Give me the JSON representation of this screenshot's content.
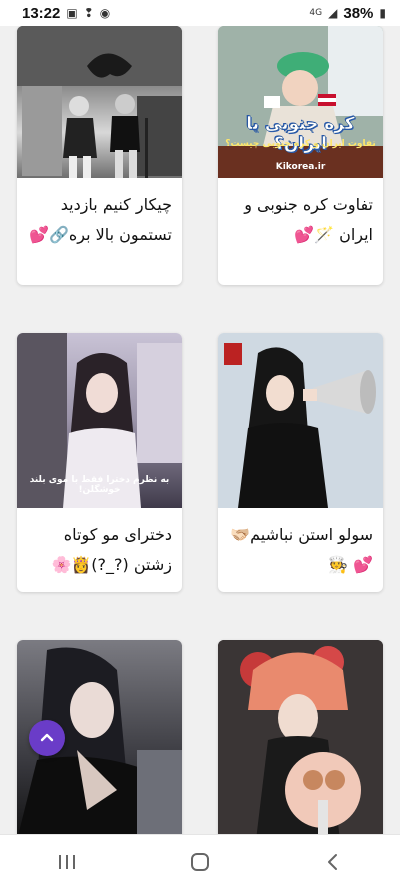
{
  "status_bar": {
    "time": "13:22",
    "network": "4G",
    "battery": "38%"
  },
  "cards": [
    {
      "title": "چیکار کنیم بازدید تستمون بالا بره🔗💕",
      "image_desc": "two girls in recording studio, black and white"
    },
    {
      "title": "تفاوت کره جنوبی و ایران 🪄💕",
      "overlay_headline": "کره جنوبی یا ایران؟",
      "overlay_sub": "تفاوت ایران و کره جنوبی چیست؟",
      "overlay_watermark": "Kikorea.ir"
    },
    {
      "title": "دخترای مو کوتاه زشتن (?_?)👸🌸",
      "overlay_caption": "به نظرم دخترا فقط با موی بلند خوشگلن!"
    },
    {
      "title": "سولو استن نباشیم🫱🏻‍🫲🏼💕 🧑‍🍳"
    },
    {
      "title": ""
    },
    {
      "title": ""
    }
  ],
  "colors": {
    "fab": "#6a3cc8",
    "background": "#f0f0f0"
  },
  "icons": {
    "fab": "chevron-up-icon",
    "nav": [
      "recent-apps-icon",
      "home-icon",
      "back-icon"
    ]
  }
}
